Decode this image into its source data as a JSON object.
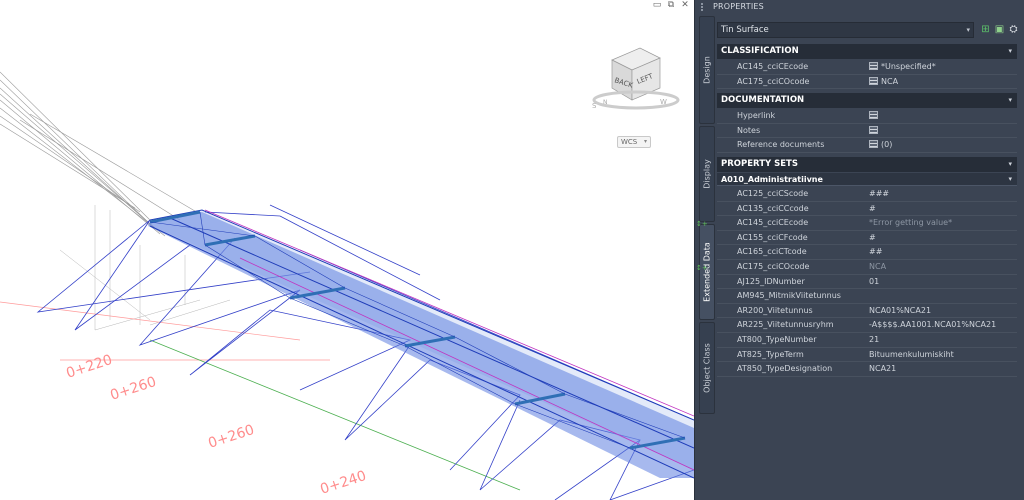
{
  "viewport": {
    "window_controls": [
      "▭",
      "⧉",
      "✕"
    ],
    "viewcube": {
      "face_back": "BACK",
      "face_left": "LEFT",
      "corner_s": "S",
      "corner_w": "W",
      "corner_n": "N"
    },
    "wcs_label": "WCS",
    "station_labels": [
      "0+220",
      "0+260",
      "0+260",
      "0+240"
    ]
  },
  "palette": {
    "title": "PROPERTIES",
    "tabs": [
      "Design",
      "Display",
      "Extended Data",
      "Object Class"
    ],
    "active_tab": "Extended Data",
    "object_type": "Tin Surface",
    "toolbar_icons": [
      "add-icon",
      "select-objects-icon",
      "quick-select-icon"
    ],
    "sections": {
      "classification": {
        "title": "CLASSIFICATION",
        "rows": [
          {
            "name": "AC145_cciCEcode",
            "value": "*Unspecified*"
          },
          {
            "name": "AC175_cciCOcode",
            "value": "NCA"
          }
        ]
      },
      "documentation": {
        "title": "DOCUMENTATION",
        "rows": [
          {
            "name": "Hyperlink",
            "value": ""
          },
          {
            "name": "Notes",
            "value": ""
          },
          {
            "name": "Reference documents",
            "value": "(0)"
          }
        ]
      },
      "property_sets": {
        "title": "PROPERTY SETS",
        "set_name": "A010_Administratiivne",
        "rows": [
          {
            "name": "AC125_cciCScode",
            "value": "###"
          },
          {
            "name": "AC135_cciCCcode",
            "value": "#"
          },
          {
            "name": "AC145_cciCEcode",
            "value": "*Error getting value*"
          },
          {
            "name": "AC155_cciCFcode",
            "value": "#"
          },
          {
            "name": "AC165_cciCTcode",
            "value": "##"
          },
          {
            "name": "AC175_cciCOcode",
            "value": "NCA"
          },
          {
            "name": "AJ125_IDNumber",
            "value": "01"
          },
          {
            "name": "AM945_MitmikViitetunnus",
            "value": ""
          },
          {
            "name": "AR200_Viitetunnus",
            "value": "NCA01%NCA21"
          },
          {
            "name": "AR225_Viitetunnusryhm",
            "value": "-A$$$$.AA1001.NCA01%NCA21"
          },
          {
            "name": "AT800_TypeNumber",
            "value": "21"
          },
          {
            "name": "AT825_TypeTerm",
            "value": "Bituumenkulumiskiht"
          },
          {
            "name": "AT850_TypeDesignation",
            "value": "NCA21"
          }
        ]
      }
    }
  }
}
